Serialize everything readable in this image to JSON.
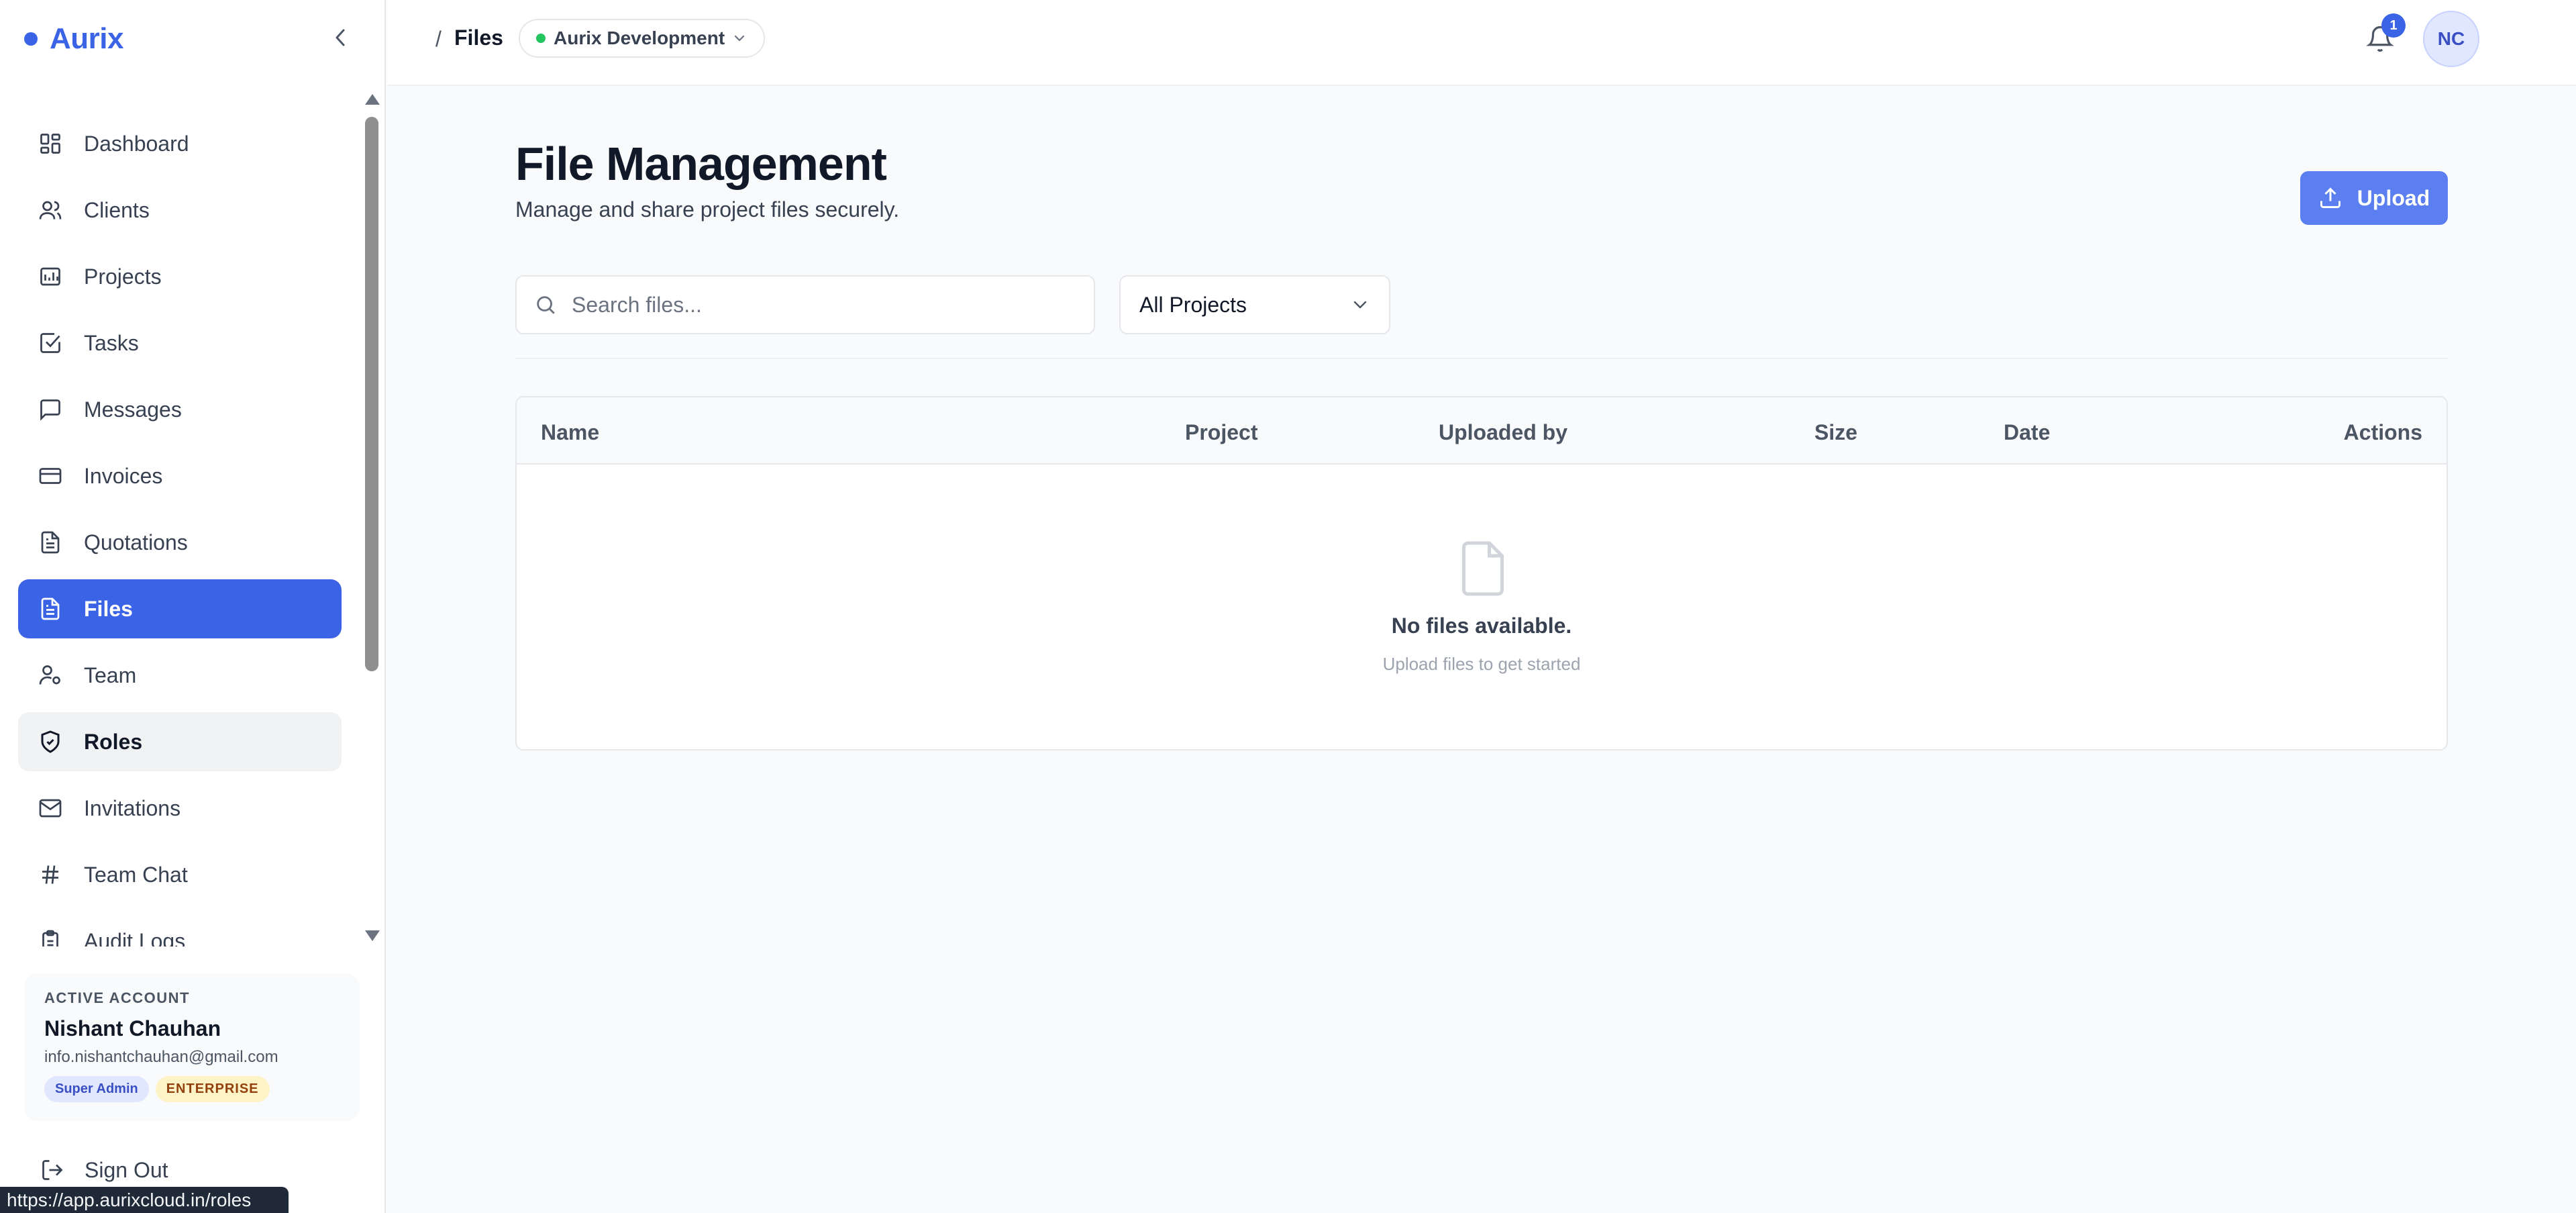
{
  "brand": {
    "name": "Aurix",
    "accent": "#3b63e6"
  },
  "sidebar": {
    "items": [
      {
        "label": "Dashboard",
        "icon": "dashboard-icon"
      },
      {
        "label": "Clients",
        "icon": "users-icon"
      },
      {
        "label": "Projects",
        "icon": "chart-icon"
      },
      {
        "label": "Tasks",
        "icon": "checkbox-icon"
      },
      {
        "label": "Messages",
        "icon": "message-icon"
      },
      {
        "label": "Invoices",
        "icon": "card-icon"
      },
      {
        "label": "Quotations",
        "icon": "document-icon"
      },
      {
        "label": "Files",
        "icon": "file-icon",
        "state": "active"
      },
      {
        "label": "Team",
        "icon": "user-settings-icon"
      },
      {
        "label": "Roles",
        "icon": "shield-icon",
        "state": "hover"
      },
      {
        "label": "Invitations",
        "icon": "mail-icon"
      },
      {
        "label": "Team Chat",
        "icon": "hash-icon"
      },
      {
        "label": "Audit Logs",
        "icon": "clipboard-icon"
      }
    ]
  },
  "account": {
    "label": "ACTIVE ACCOUNT",
    "name": "Nishant Chauhan",
    "email": "info.nishantchauhan@gmail.com",
    "role_badge": "Super Admin",
    "plan_badge": "ENTERPRISE"
  },
  "signout_label": "Sign Out",
  "status_url": "https://app.aurixcloud.in/roles",
  "header": {
    "breadcrumb_sep": "/",
    "breadcrumb_current": "Files",
    "workspace": "Aurix Development",
    "notification_count": "1",
    "avatar_initials": "NC"
  },
  "main": {
    "title": "File Management",
    "subtitle": "Manage and share project files securely.",
    "upload_label": "Upload",
    "search_placeholder": "Search files...",
    "project_filter": "All Projects",
    "columns": [
      "Name",
      "Project",
      "Uploaded by",
      "Size",
      "Date",
      "Actions"
    ],
    "empty_title": "No files available.",
    "empty_subtitle": "Upload files to get started"
  }
}
